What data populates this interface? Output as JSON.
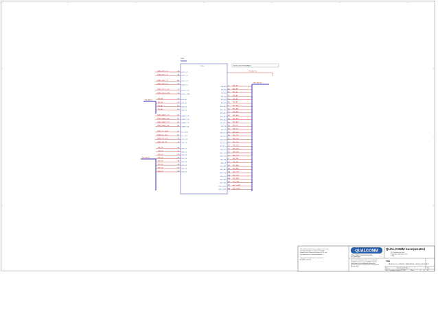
{
  "schematic": {
    "ic": {
      "refdes": "U100",
      "left_pins": [
        {
          "net": "MDM_GPIO_72",
          "pin": "A2",
          "label": "GPIO_72"
        },
        {
          "net": "MDM_GPIO_73",
          "pin": "A3",
          "label": "GPIO_73"
        },
        {
          "net": "MDM_GPIO_74",
          "pin": "B4",
          "label": "GPIO_74"
        },
        {
          "net": "MDM_GPIO_75",
          "pin": "B5",
          "label": "GPIO_75"
        },
        {
          "net": "MDM_SDC1_CLK",
          "pin": "C2",
          "label": "SDC1_CLK"
        },
        {
          "net": "MDM_SDC1_CMD",
          "pin": "C3",
          "label": "SDC1_CMD"
        },
        {
          "net": "EBI_A0",
          "pin": "D1",
          "label": "EBI_A0"
        },
        {
          "net": "EBI_A1",
          "pin": "D2",
          "label": "EBI_A1"
        },
        {
          "net": "EBI_A2",
          "pin": "D3",
          "label": "EBI_A2"
        },
        {
          "net": "EBI_A3",
          "pin": "D4",
          "label": "EBI_A3"
        },
        {
          "net": "MDM_UART1_TX",
          "pin": "E1",
          "label": "UART1_TX"
        },
        {
          "net": "MDM_UART1_RX",
          "pin": "E2",
          "label": "UART1_RX"
        },
        {
          "net": "MDM_UART2_TX",
          "pin": "E3",
          "label": "UART2_TX"
        },
        {
          "net": "MDM_UART2_RX",
          "pin": "E4",
          "label": "UART2_RX"
        },
        {
          "net": "MDM_I2C_SDA",
          "pin": "F1",
          "label": "I2C_SDA"
        },
        {
          "net": "MDM_I2C_SCL",
          "pin": "F2",
          "label": "I2C_SCL"
        },
        {
          "net": "MDM_SPI_CLK",
          "pin": "G1",
          "label": "SPI_CLK"
        },
        {
          "net": "MDM_SPI_CS",
          "pin": "G2",
          "label": "SPI_CS"
        },
        {
          "net": "EBI_D0",
          "pin": "H1",
          "label": "EBI_D0"
        },
        {
          "net": "EBI_D1",
          "pin": "H2",
          "label": "EBI_D1"
        },
        {
          "net": "EBI_D2",
          "pin": "H3",
          "label": "EBI_D2"
        },
        {
          "net": "EBI_D3",
          "pin": "H4",
          "label": "EBI_D3"
        },
        {
          "net": "EBI_D4",
          "pin": "H5",
          "label": "EBI_D4"
        },
        {
          "net": "EBI_D5",
          "pin": "H6",
          "label": "EBI_D5"
        },
        {
          "net": "EBI_D6",
          "pin": "H7",
          "label": "EBI_D6"
        },
        {
          "net": "EBI_D7",
          "pin": "H8",
          "label": "EBI_D7"
        }
      ],
      "right_pins": [
        {
          "net": "EBI_A4",
          "pin": "J1",
          "label": "EBI_A4"
        },
        {
          "net": "EBI_A5",
          "pin": "J2",
          "label": "EBI_A5"
        },
        {
          "net": "EBI_A6",
          "pin": "J3",
          "label": "EBI_A6"
        },
        {
          "net": "EBI_A7",
          "pin": "J4",
          "label": "EBI_A7"
        },
        {
          "net": "EBI_A8",
          "pin": "J5",
          "label": "EBI_A8"
        },
        {
          "net": "EBI_A9",
          "pin": "J6",
          "label": "EBI_A9"
        },
        {
          "net": "EBI_A10",
          "pin": "J7",
          "label": "EBI_A10"
        },
        {
          "net": "EBI_A11",
          "pin": "J8",
          "label": "EBI_A11"
        },
        {
          "net": "EBI_A12",
          "pin": "K1",
          "label": "EBI_A12"
        },
        {
          "net": "EBI_A13",
          "pin": "K2",
          "label": "EBI_A13"
        },
        {
          "net": "EBI_A14",
          "pin": "K3",
          "label": "EBI_A14"
        },
        {
          "net": "EBI_A15",
          "pin": "K4",
          "label": "EBI_A15"
        },
        {
          "net": "EBI_D8",
          "pin": "K5",
          "label": "EBI_D8"
        },
        {
          "net": "EBI_D9",
          "pin": "K6",
          "label": "EBI_D9"
        },
        {
          "net": "EBI_D10",
          "pin": "K7",
          "label": "EBI_D10"
        },
        {
          "net": "EBI_D11",
          "pin": "K8",
          "label": "EBI_D11"
        },
        {
          "net": "EBI_D12",
          "pin": "L1",
          "label": "EBI_D12"
        },
        {
          "net": "EBI_D13",
          "pin": "L2",
          "label": "EBI_D13"
        },
        {
          "net": "EBI_D14",
          "pin": "L3",
          "label": "EBI_D14"
        },
        {
          "net": "EBI_D15",
          "pin": "L4",
          "label": "EBI_D15"
        },
        {
          "net": "EBI_CS0",
          "pin": "L5",
          "label": "EBI_CS0"
        },
        {
          "net": "EBI_CS1",
          "pin": "L6",
          "label": "EBI_CS1"
        },
        {
          "net": "EBI_WE",
          "pin": "L7",
          "label": "EBI_WE"
        },
        {
          "net": "EBI_OE",
          "pin": "L8",
          "label": "EBI_OE"
        },
        {
          "net": "EBI_BA0",
          "pin": "M1",
          "label": "EBI_BA0"
        },
        {
          "net": "EBI_BA1",
          "pin": "M2",
          "label": "EBI_BA1"
        },
        {
          "net": "EBI_CKE",
          "pin": "M3",
          "label": "EBI_CKE"
        },
        {
          "net": "EBI_CLK",
          "pin": "M4",
          "label": "EBI_CLK"
        },
        {
          "net": "EBI_RAS",
          "pin": "M5",
          "label": "EBI_RAS"
        },
        {
          "net": "EBI_CAS",
          "pin": "M6",
          "label": "EBI_CAS"
        },
        {
          "net": "EBI_DQM0",
          "pin": "M7",
          "label": "EBI_DQM0"
        },
        {
          "net": "EBI_DQM1",
          "pin": "M8",
          "label": "EBI_DQM1"
        }
      ],
      "top_right_net": "EBI_A[15:0]"
    },
    "buses": {
      "left_top": "EBI_A[3:0]",
      "left_bottom": "EBI_D[7:0]",
      "right": "EBI_D[15:0]"
    },
    "note": "NOTE: DNI FOR DEFAULT"
  },
  "title_block": {
    "company": "QUALCOMM Incorporated",
    "logo_text": "QUALCOMM",
    "address_lines": [
      "5775 Morehouse Drive",
      "San Diego, CA 92121-1714",
      "U.S.A."
    ],
    "confidential_lines": [
      "QUALCOMM CONFIDENTIAL AND",
      "PROPRIETARY"
    ],
    "notice_lines": [
      "Restricted Distribution. Not to be distributed",
      "to anyone who is not an employee of either",
      "Qualcomm or its subsidiaries without the",
      "express approval of Qualcomm's Configuration",
      "Management."
    ],
    "left_notice_lines": [
      "This technical data may be subject to U.S. and",
      "international export, re-export or transfer",
      "(export) laws. Diversion contrary to U.S. and",
      "international law is strictly prohibited.",
      "",
      "Copyright (c) Qualcomm Incorporated",
      "All rights reserved."
    ],
    "title_label": "Title",
    "title_value": "MDM9x15_PCI_GENERIC_REFERENCE_DESIGN: EBI1 & GPIO",
    "size_label": "Size",
    "size_value": "C",
    "doc_label": "Document Number",
    "rev_label": "Rev",
    "date_label": "Date:",
    "date_value": "Tuesday, October 23, 2012",
    "sheet_label": "Sheet",
    "sheet_value": "6",
    "of_label": "of",
    "of_value": "44"
  }
}
